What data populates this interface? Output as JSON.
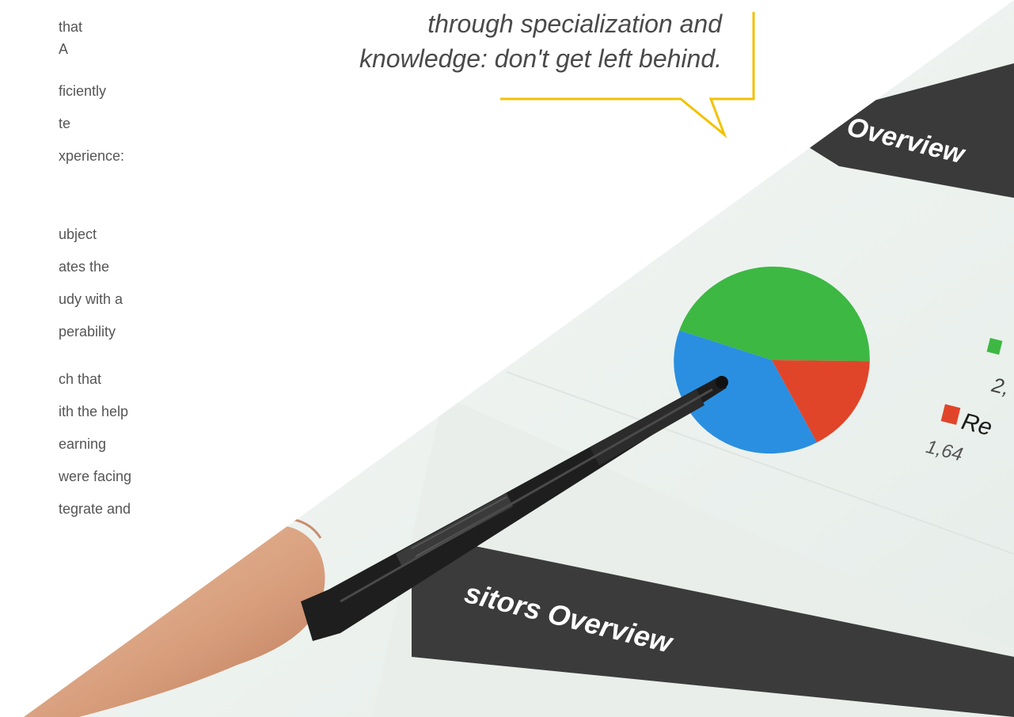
{
  "left_text": {
    "para1": [
      "that",
      "A",
      "ficiently",
      "te",
      "xperience:"
    ],
    "para2": [
      "ubject",
      "ates the",
      "udy with a",
      "perability"
    ],
    "para3": [
      "ch that",
      "ith the help",
      "earning",
      "were facing",
      "tegrate and"
    ]
  },
  "quote": {
    "line1": "through specialization and",
    "line2": "knowledge: don't get left behind."
  },
  "photo": {
    "header_top": "Overview",
    "header_bottom": "sitors Overview",
    "legend_1_value": "2,",
    "legend_2_label": "Re",
    "legend_2_value": "1,64"
  },
  "chart_data": {
    "type": "pie",
    "slices": [
      {
        "color": "#3db843",
        "share": 0.45
      },
      {
        "color": "#e0452a",
        "share": 0.17
      },
      {
        "color": "#2a8fe0",
        "share": 0.38
      }
    ]
  },
  "colors": {
    "accent_yellow": "#f2c200",
    "header_dark": "#3a3a3a",
    "screen_bg": "#eef3f0"
  }
}
